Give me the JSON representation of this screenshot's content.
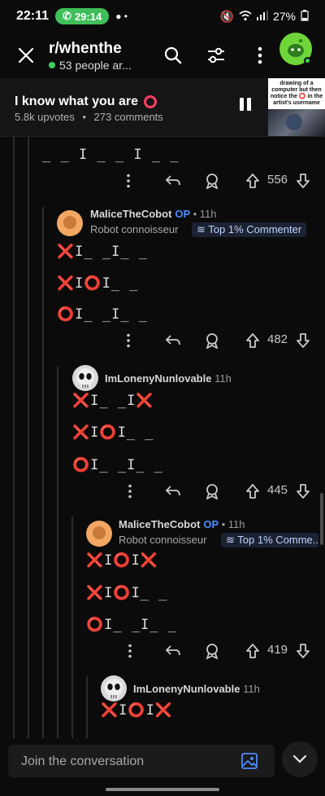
{
  "status_bar": {
    "time": "22:11",
    "call_timer": "29:14",
    "battery": "27%"
  },
  "header": {
    "subreddit": "r/whenthe",
    "online": "53 people ar..."
  },
  "post": {
    "title": "I know what you are",
    "upvotes": "5.8k upvotes",
    "separator": "•",
    "comments": "273 comments",
    "thumbnail_text": "drawing of a computer but then notice the ⭕ in the artist's username"
  },
  "comments": [
    {
      "lines": [
        "_ _ I _ _ I _ _"
      ],
      "score": "556"
    },
    {
      "username": "MaliceTheCobot",
      "op": "OP",
      "time": "• 11h",
      "flair": "Robot connoisseur",
      "badge": "Top 1% Commenter",
      "lines": [
        "❌I_ _I_ _",
        "❌I⭕I_ _",
        "⭕I_ _I_ _"
      ],
      "score": "482"
    },
    {
      "username": "ImLonenyNunlovable",
      "time": "11h",
      "lines": [
        "❌I_ _I❌",
        "❌I⭕I_ _",
        "⭕I_ _I_ _"
      ],
      "score": "445"
    },
    {
      "username": "MaliceTheCobot",
      "op": "OP",
      "time": "• 11h",
      "flair": "Robot connoisseur",
      "badge": "Top 1% Comme...",
      "lines": [
        "❌I⭕I❌",
        "❌I⭕I_ _",
        "⭕I_ _I_ _"
      ],
      "score": "419"
    },
    {
      "username": "ImLonenyNunlovable",
      "time": "11h",
      "lines": [
        "❌I⭕I❌"
      ]
    }
  ],
  "composer": {
    "placeholder": "Join the conversation"
  }
}
